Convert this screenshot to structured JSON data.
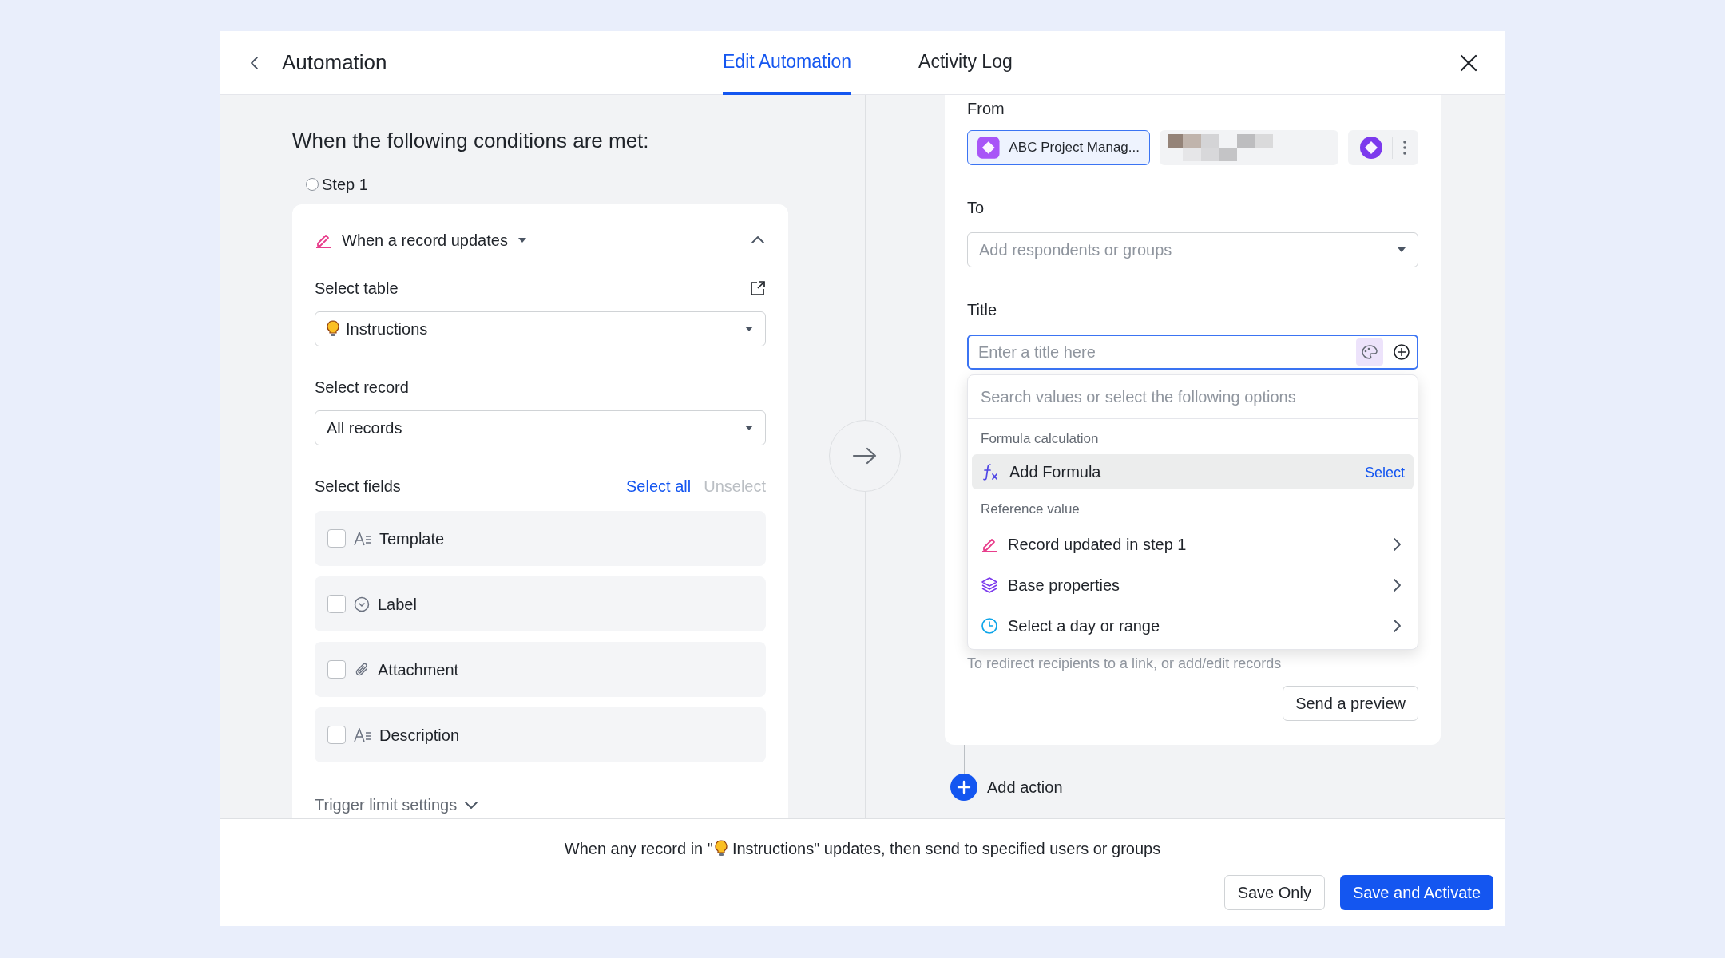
{
  "header": {
    "title": "Automation",
    "tabs": [
      {
        "label": "Edit Automation",
        "selected": true
      },
      {
        "label": "Activity Log",
        "selected": false
      }
    ]
  },
  "trigger": {
    "heading": "When the following conditions are met:",
    "step": "Step 1",
    "event": "When a record updates",
    "expanded": true,
    "table_label": "Select table",
    "table_value": "Instructions",
    "record_label": "Select record",
    "record_value": "All records",
    "fields_label": "Select fields",
    "select_all": "Select all",
    "unselect": "Unselect",
    "fields": [
      {
        "name": "Template",
        "kind": "text",
        "checked": false
      },
      {
        "name": "Label",
        "kind": "option",
        "checked": false
      },
      {
        "name": "Attachment",
        "kind": "attachment",
        "checked": false
      },
      {
        "name": "Description",
        "kind": "text",
        "checked": false
      }
    ],
    "trigger_limit": "Trigger limit settings"
  },
  "action": {
    "from_label": "From",
    "from_app": "ABC Project Manag...",
    "to_label": "To",
    "to_placeholder": "Add respondents or groups",
    "title_label": "Title",
    "title_placeholder": "Enter a title here",
    "menu": {
      "search_placeholder": "Search values or select the following options",
      "sections": [
        {
          "heading": "Formula calculation",
          "items": [
            {
              "label": "Add Formula",
              "kind": "formula",
              "selected": true,
              "action": "Select"
            }
          ]
        },
        {
          "heading": "Reference value",
          "items": [
            {
              "label": "Record updated in step 1",
              "kind": "record",
              "selected": false
            },
            {
              "label": "Base properties",
              "kind": "base",
              "selected": false
            },
            {
              "label": "Select a day or range",
              "kind": "date",
              "selected": false
            }
          ]
        }
      ]
    },
    "hint": "To redirect recipients to a link, or add/edit records",
    "preview_button": "Send a preview",
    "add_action": "Add action"
  },
  "footer": {
    "summary_before": "When any record in \"",
    "summary_after": "Instructions\" updates, then send to specified users or groups",
    "buttons": [
      {
        "label": "Save Only",
        "kind": "secondary"
      },
      {
        "label": "Save and Activate",
        "kind": "primary"
      }
    ]
  }
}
